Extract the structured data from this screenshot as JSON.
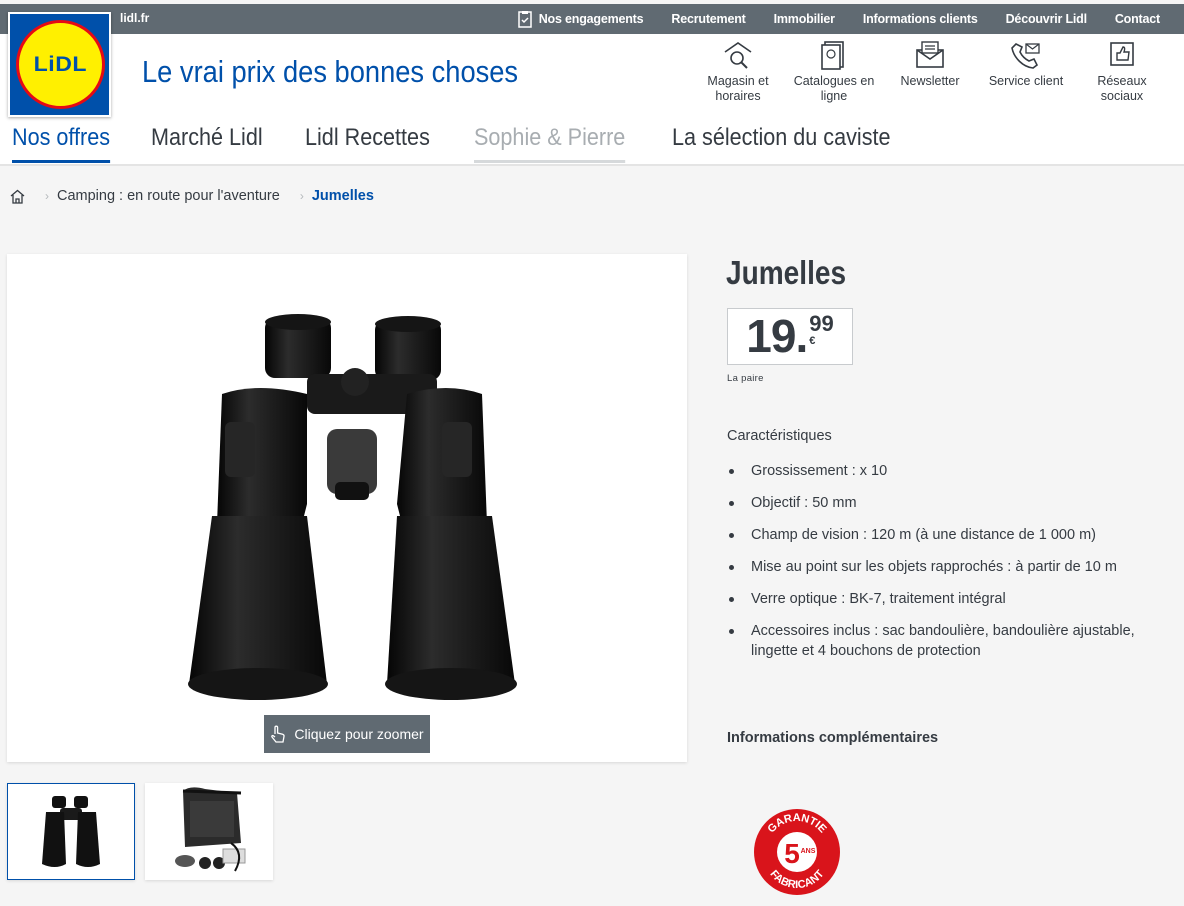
{
  "topbar": {
    "site": "lidl.fr",
    "links": [
      "Nos engagements",
      "Recrutement",
      "Immobilier",
      "Informations clients",
      "Découvrir Lidl",
      "Contact"
    ]
  },
  "header": {
    "logo_text": "LiDL",
    "tagline": "Le vrai prix des bonnes choses",
    "services": [
      {
        "line1": "Magasin et",
        "line2": "horaires",
        "icon": "store-search-icon"
      },
      {
        "line1": "Catalogues en",
        "line2": "ligne",
        "icon": "catalogue-icon"
      },
      {
        "line1": "Newsletter",
        "line2": "",
        "icon": "newsletter-icon"
      },
      {
        "line1": "Service client",
        "line2": "",
        "icon": "customer-service-icon"
      },
      {
        "line1": "Réseaux",
        "line2": "sociaux",
        "icon": "social-like-icon"
      }
    ],
    "nav": [
      "Nos offres",
      "Marché Lidl",
      "Lidl Recettes",
      "Sophie & Pierre",
      "La sélection du caviste"
    ]
  },
  "breadcrumb": {
    "category": "Camping : en route pour l'aventure",
    "current": "Jumelles"
  },
  "gallery": {
    "zoom_label": "Cliquez pour zoomer"
  },
  "product": {
    "title": "Jumelles",
    "price_int": "19",
    "price_dec": "99",
    "currency": "€",
    "unit": "La paire",
    "features_heading": "Caractéristiques",
    "features": [
      "Grossissement :  x 10",
      "Objectif : 50 mm",
      "Champ de vision : 120 m (à une distance de 1 000 m)",
      "Mise au point sur les objets rapprochés : à partir de 10 m",
      "Verre optique : BK-7, traitement intégral",
      "Accessoires inclus : sac bandoulière, bandoulière ajustable, lingette et 4 bouchons de protection"
    ],
    "more_info": "Informations complémentaires",
    "badge": {
      "top": "GARANTIE",
      "num": "5",
      "ans": "ANS",
      "bottom": "FABRICANT"
    }
  },
  "colors": {
    "brand_blue": "#0050aa",
    "brand_yellow": "#fff000",
    "brand_red": "#e60a14",
    "topbar": "#606a72"
  }
}
